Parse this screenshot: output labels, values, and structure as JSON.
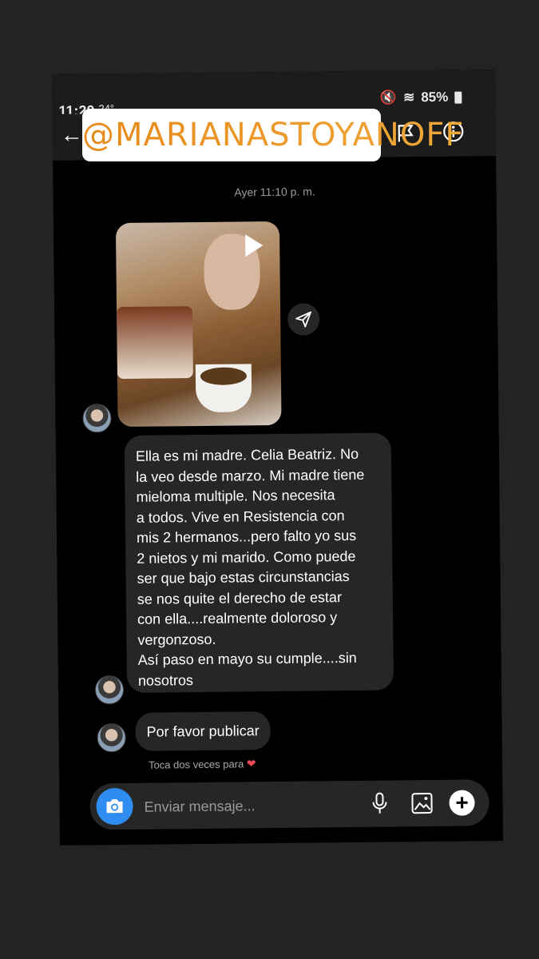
{
  "status_bar": {
    "time": "11:20",
    "temperature": "24°",
    "battery": "85%"
  },
  "header": {
    "overlay_tag": "@MARIANASTOYANOFF"
  },
  "chat": {
    "timestamp": "Ayer 11:10 p. m.",
    "messages": [
      {
        "text": "Ella es mi madre.  Celia Beatriz.  No\nla veo desde marzo. Mi madre tiene\nmieloma multiple.  Nos necesita\na todos. Vive en Resistencia con\nmis 2 hermanos...pero falto yo sus\n2 nietos y mi marido. Como puede\nser que bajo estas circunstancias\nse nos quite el derecho de estar\ncon ella....realmente doloroso y\nvergonzoso.\nAsí paso en mayo su cumple....sin\nnosotros"
      },
      {
        "text": "Por favor publicar"
      }
    ],
    "like_hint": "Toca dos veces para"
  },
  "composer": {
    "placeholder": "Enviar mensaje..."
  },
  "colors": {
    "tag_gradient_start": "#e58a1a",
    "tag_gradient_end": "#f1a93a",
    "camera_button": "#2f8cf0",
    "bubble": "#262626"
  }
}
